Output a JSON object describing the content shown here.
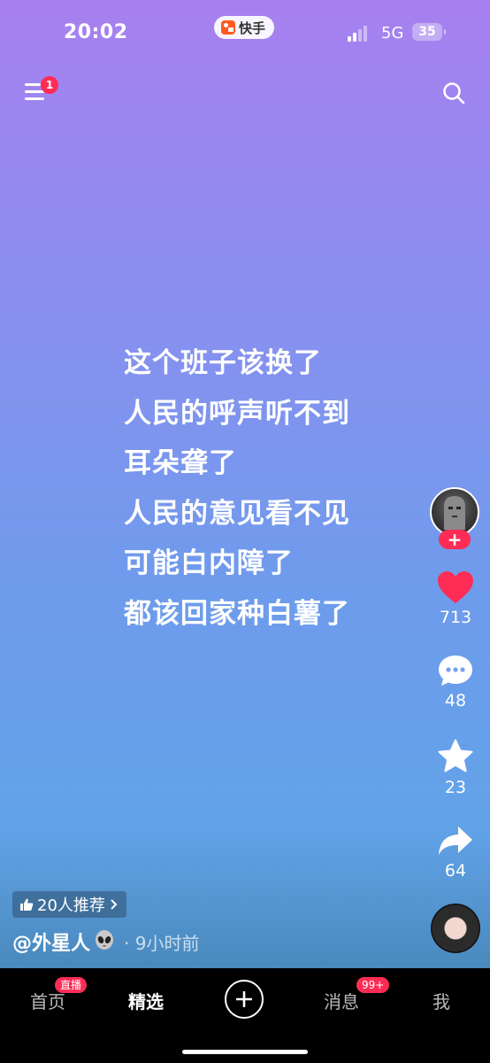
{
  "status_bar": {
    "time": "20:02",
    "app_name": "快手",
    "network": "5G",
    "battery": "35"
  },
  "top_nav": {
    "menu_badge": "1"
  },
  "post": {
    "lines": [
      "这个班子该换了",
      "人民的呼声听不到",
      "耳朵聋了",
      "人民的意见看不见",
      "可能白内障了",
      "都该回家种白薯了"
    ],
    "likes": "713",
    "comments": "48",
    "favorites": "23",
    "shares": "64",
    "recommend_text": "20人推荐",
    "author": "@外星人",
    "author_emoji": "👽",
    "time_ago": "· 9小时前"
  },
  "tabs": [
    {
      "label": "首页",
      "badge": "直播"
    },
    {
      "label": "精选"
    },
    {
      "label": "消息",
      "badge": "99+"
    },
    {
      "label": "我"
    }
  ],
  "colors": {
    "accent": "#fe2c55",
    "background_top": "#a780ef",
    "background_bottom": "#5aa7e6"
  }
}
